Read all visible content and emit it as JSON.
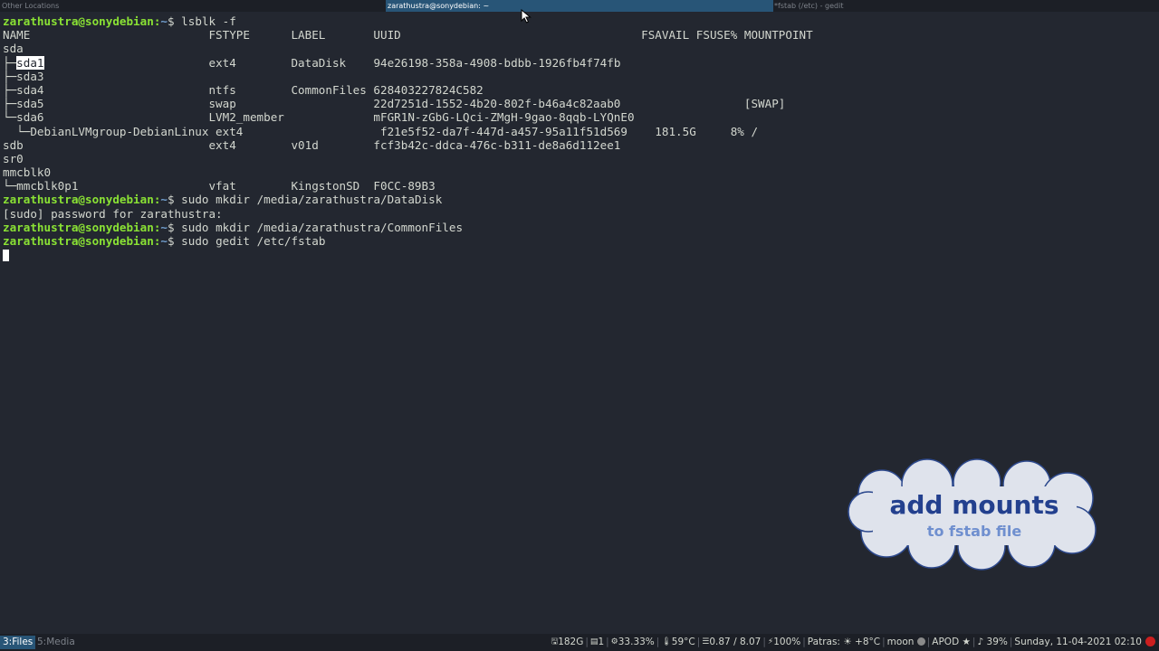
{
  "topbar": {
    "left_title": "Other Locations",
    "active_title": "zarathustra@sonydebian: ~",
    "right_title": "*fstab (/etc) - gedit"
  },
  "terminal": {
    "prompt_user": "zarathustra@sonydebian",
    "prompt_sep": ":",
    "prompt_path": "~",
    "prompt_sym": "$",
    "lines": [
      {
        "type": "cmd",
        "cmd": " lsblk -f"
      },
      {
        "type": "out",
        "text": "NAME                          FSTYPE      LABEL       UUID                                   FSAVAIL FSUSE% MOUNTPOINT"
      },
      {
        "type": "out",
        "text": "sda"
      },
      {
        "type": "hl",
        "pre": "├─",
        "hl": "sda1",
        "post": "                        ext4        DataDisk    94e26198-358a-4908-bdbb-1926fb4f74fb"
      },
      {
        "type": "out",
        "text": "├─sda3"
      },
      {
        "type": "out",
        "text": "├─sda4                        ntfs        CommonFiles 628403227824C582"
      },
      {
        "type": "out",
        "text": "├─sda5                        swap                    22d7251d-1552-4b20-802f-b46a4c82aab0                  [SWAP]"
      },
      {
        "type": "out",
        "text": "└─sda6                        LVM2_member             mFGR1N-zGbG-LQci-ZMgH-9gao-8qqb-LYQnE0"
      },
      {
        "type": "out",
        "text": "  └─DebianLVMgroup-DebianLinux ext4                    f21e5f52-da7f-447d-a457-95a11f51d569    181.5G     8% /"
      },
      {
        "type": "out",
        "text": "sdb                           ext4        v01d        fcf3b42c-ddca-476c-b311-de8a6d112ee1"
      },
      {
        "type": "out",
        "text": "sr0"
      },
      {
        "type": "out",
        "text": "mmcblk0"
      },
      {
        "type": "out",
        "text": "└─mmcblk0p1                   vfat        KingstonSD  F0CC-89B3"
      },
      {
        "type": "cmd",
        "cmd": " sudo mkdir /media/zarathustra/DataDisk"
      },
      {
        "type": "out",
        "text": "[sudo] password for zarathustra:"
      },
      {
        "type": "cmd",
        "cmd": " sudo mkdir /media/zarathustra/CommonFiles"
      },
      {
        "type": "cmd",
        "cmd": " sudo gedit /etc/fstab"
      },
      {
        "type": "cursor"
      }
    ]
  },
  "overlay": {
    "title": "add mounts",
    "subtitle": "to fstab file"
  },
  "statusbar": {
    "workspaces": [
      "3:Files",
      "5:Media"
    ],
    "items": {
      "disk": "182G",
      "notes": "1",
      "cpu": "33.33%",
      "temp": "59°C",
      "load": "0.87 / 8.07",
      "battery": "100%",
      "weather": "Patras: ☀ +8°C",
      "moon": "moon",
      "apod": "APOD ★",
      "volume": "♪ 39%",
      "datetime": "Sunday, 11-04-2021 02:10"
    }
  },
  "colors": {
    "background": "#232730",
    "prompt_user": "#8ae234",
    "prompt_path": "#729fcf",
    "active_tab": "#285577",
    "cloud_title": "#23408e"
  }
}
